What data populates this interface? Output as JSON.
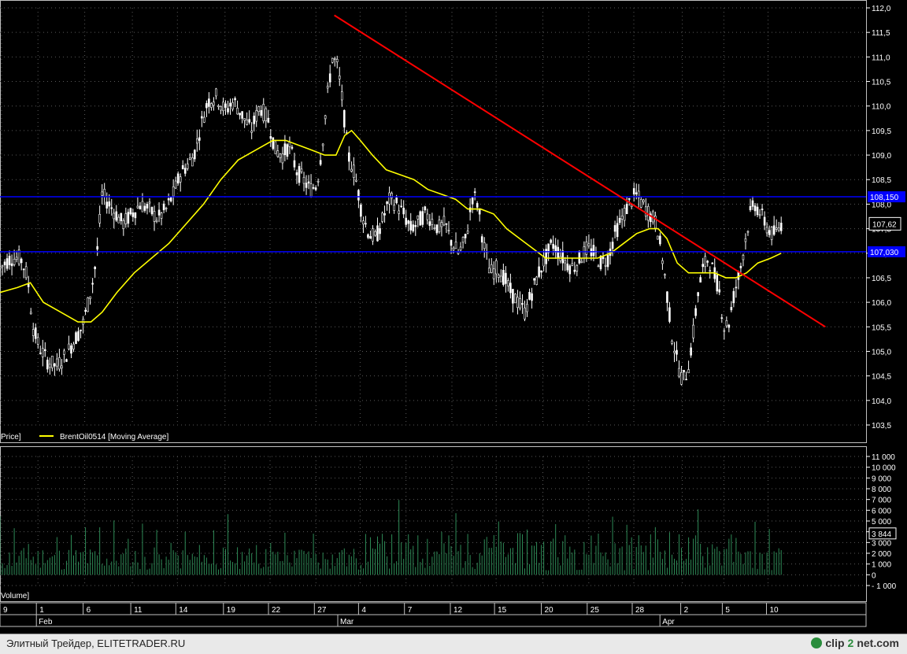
{
  "chart_data": [
    {
      "type": "candlestick",
      "ylim": [
        103.5,
        112.0
      ],
      "yticks": [
        "112,0",
        "111,5",
        "111,0",
        "110,5",
        "110,0",
        "109,5",
        "109,0",
        "108,5",
        "108,0",
        "107,5",
        "107,0",
        "106,5",
        "106,0",
        "105,5",
        "105,0",
        "104,5",
        "104,0",
        "103,5"
      ],
      "legend_left": "Price]",
      "legend_series": "BrentOil0514 [Moving Average]",
      "hlines": [
        {
          "value": 108.15,
          "label": "108,150",
          "color": "#0000ff"
        },
        {
          "value": 107.03,
          "label": "107,030",
          "color": "#0000ff"
        }
      ],
      "last_price_label": "107,62",
      "trendline": {
        "x": [
          0.386,
          0.953
        ],
        "y": [
          111.85,
          105.5
        ],
        "color": "#ff0000"
      },
      "grid": true,
      "colors": {
        "candle": "#ffffff",
        "ma": "#ffff00",
        "hline": "#0000ff",
        "trend": "#ff0000"
      },
      "price_path": [
        [
          0.0,
          106.7
        ],
        [
          0.012,
          106.9
        ],
        [
          0.024,
          106.9
        ],
        [
          0.032,
          106.5
        ],
        [
          0.038,
          105.5
        ],
        [
          0.045,
          105.1
        ],
        [
          0.055,
          104.8
        ],
        [
          0.065,
          104.7
        ],
        [
          0.075,
          104.9
        ],
        [
          0.085,
          105.2
        ],
        [
          0.095,
          105.5
        ],
        [
          0.102,
          106.0
        ],
        [
          0.108,
          106.5
        ],
        [
          0.112,
          107.0
        ],
        [
          0.118,
          108.2
        ],
        [
          0.126,
          108.0
        ],
        [
          0.134,
          107.8
        ],
        [
          0.142,
          107.6
        ],
        [
          0.152,
          107.8
        ],
        [
          0.162,
          108.0
        ],
        [
          0.172,
          107.9
        ],
        [
          0.182,
          107.7
        ],
        [
          0.192,
          107.9
        ],
        [
          0.2,
          108.2
        ],
        [
          0.208,
          108.6
        ],
        [
          0.216,
          108.8
        ],
        [
          0.224,
          109.0
        ],
        [
          0.232,
          109.6
        ],
        [
          0.24,
          110.1
        ],
        [
          0.25,
          110.2
        ],
        [
          0.26,
          109.9
        ],
        [
          0.27,
          110.1
        ],
        [
          0.28,
          109.8
        ],
        [
          0.29,
          109.5
        ],
        [
          0.3,
          110.0
        ],
        [
          0.31,
          109.7
        ],
        [
          0.318,
          109.1
        ],
        [
          0.326,
          109.0
        ],
        [
          0.334,
          109.2
        ],
        [
          0.342,
          108.7
        ],
        [
          0.35,
          108.5
        ],
        [
          0.358,
          108.3
        ],
        [
          0.366,
          108.4
        ],
        [
          0.372,
          109.2
        ],
        [
          0.378,
          110.2
        ],
        [
          0.384,
          111.0
        ],
        [
          0.39,
          110.8
        ],
        [
          0.396,
          110.0
        ],
        [
          0.402,
          109.0
        ],
        [
          0.41,
          108.6
        ],
        [
          0.418,
          107.8
        ],
        [
          0.426,
          107.4
        ],
        [
          0.434,
          107.3
        ],
        [
          0.442,
          107.7
        ],
        [
          0.45,
          108.1
        ],
        [
          0.458,
          108.0
        ],
        [
          0.466,
          107.8
        ],
        [
          0.474,
          107.5
        ],
        [
          0.482,
          107.6
        ],
        [
          0.49,
          107.8
        ],
        [
          0.498,
          107.7
        ],
        [
          0.506,
          107.5
        ],
        [
          0.514,
          107.6
        ],
        [
          0.522,
          107.2
        ],
        [
          0.53,
          107.0
        ],
        [
          0.538,
          107.3
        ],
        [
          0.546,
          108.2
        ],
        [
          0.552,
          108.0
        ],
        [
          0.558,
          107.2
        ],
        [
          0.566,
          106.6
        ],
        [
          0.574,
          106.7
        ],
        [
          0.582,
          106.5
        ],
        [
          0.59,
          106.2
        ],
        [
          0.598,
          106.0
        ],
        [
          0.606,
          105.8
        ],
        [
          0.614,
          106.2
        ],
        [
          0.622,
          106.6
        ],
        [
          0.63,
          106.9
        ],
        [
          0.638,
          107.2
        ],
        [
          0.646,
          107.0
        ],
        [
          0.654,
          106.8
        ],
        [
          0.662,
          106.7
        ],
        [
          0.67,
          106.9
        ],
        [
          0.678,
          107.1
        ],
        [
          0.686,
          107.0
        ],
        [
          0.694,
          106.8
        ],
        [
          0.702,
          106.9
        ],
        [
          0.71,
          107.4
        ],
        [
          0.718,
          107.7
        ],
        [
          0.726,
          108.0
        ],
        [
          0.734,
          108.2
        ],
        [
          0.742,
          108.0
        ],
        [
          0.75,
          107.8
        ],
        [
          0.758,
          107.6
        ],
        [
          0.764,
          107.0
        ],
        [
          0.77,
          106.2
        ],
        [
          0.776,
          105.3
        ],
        [
          0.782,
          104.8
        ],
        [
          0.788,
          104.4
        ],
        [
          0.794,
          104.6
        ],
        [
          0.8,
          105.3
        ],
        [
          0.806,
          106.2
        ],
        [
          0.812,
          106.7
        ],
        [
          0.818,
          106.9
        ],
        [
          0.824,
          106.6
        ],
        [
          0.83,
          106.3
        ],
        [
          0.836,
          105.5
        ],
        [
          0.842,
          105.6
        ],
        [
          0.848,
          106.2
        ],
        [
          0.854,
          106.6
        ],
        [
          0.86,
          107.2
        ],
        [
          0.866,
          107.8
        ],
        [
          0.872,
          108.0
        ],
        [
          0.878,
          107.8
        ],
        [
          0.884,
          107.6
        ],
        [
          0.89,
          107.4
        ],
        [
          0.896,
          107.4
        ],
        [
          0.902,
          107.6
        ]
      ],
      "ma_path": [
        [
          0.0,
          106.2
        ],
        [
          0.02,
          106.3
        ],
        [
          0.035,
          106.4
        ],
        [
          0.05,
          106.0
        ],
        [
          0.07,
          105.8
        ],
        [
          0.09,
          105.6
        ],
        [
          0.105,
          105.6
        ],
        [
          0.118,
          105.8
        ],
        [
          0.135,
          106.2
        ],
        [
          0.155,
          106.6
        ],
        [
          0.175,
          106.9
        ],
        [
          0.195,
          107.2
        ],
        [
          0.215,
          107.6
        ],
        [
          0.235,
          108.0
        ],
        [
          0.255,
          108.5
        ],
        [
          0.275,
          108.9
        ],
        [
          0.295,
          109.1
        ],
        [
          0.315,
          109.3
        ],
        [
          0.33,
          109.3
        ],
        [
          0.345,
          109.2
        ],
        [
          0.36,
          109.1
        ],
        [
          0.375,
          109.0
        ],
        [
          0.388,
          109.0
        ],
        [
          0.398,
          109.4
        ],
        [
          0.406,
          109.5
        ],
        [
          0.416,
          109.3
        ],
        [
          0.43,
          109.0
        ],
        [
          0.446,
          108.7
        ],
        [
          0.462,
          108.6
        ],
        [
          0.478,
          108.5
        ],
        [
          0.494,
          108.3
        ],
        [
          0.51,
          108.2
        ],
        [
          0.526,
          108.1
        ],
        [
          0.54,
          107.9
        ],
        [
          0.555,
          107.9
        ],
        [
          0.57,
          107.8
        ],
        [
          0.585,
          107.5
        ],
        [
          0.6,
          107.3
        ],
        [
          0.615,
          107.1
        ],
        [
          0.63,
          106.9
        ],
        [
          0.645,
          106.9
        ],
        [
          0.66,
          106.9
        ],
        [
          0.675,
          106.9
        ],
        [
          0.69,
          106.9
        ],
        [
          0.705,
          107.0
        ],
        [
          0.72,
          107.2
        ],
        [
          0.735,
          107.4
        ],
        [
          0.75,
          107.5
        ],
        [
          0.76,
          107.5
        ],
        [
          0.77,
          107.3
        ],
        [
          0.782,
          106.8
        ],
        [
          0.795,
          106.6
        ],
        [
          0.81,
          106.6
        ],
        [
          0.825,
          106.6
        ],
        [
          0.838,
          106.5
        ],
        [
          0.85,
          106.5
        ],
        [
          0.862,
          106.6
        ],
        [
          0.875,
          106.8
        ],
        [
          0.89,
          106.9
        ],
        [
          0.902,
          107.0
        ]
      ]
    },
    {
      "type": "bar",
      "ylim": [
        -1000,
        11000
      ],
      "yticks": [
        "11 000",
        "10 000",
        "9 000",
        "8 000",
        "7 000",
        "6 000",
        "5 000",
        "4 000",
        "3 000",
        "2 000",
        "1 000",
        "0",
        "- 1 000"
      ],
      "legend_left": "Volume]",
      "last_value_label": "3 844",
      "color": "#2e8b57"
    }
  ],
  "x_axis": {
    "day_ticks": [
      {
        "x": 0.0,
        "label": "9"
      },
      {
        "x": 0.042,
        "label": "1"
      },
      {
        "x": 0.096,
        "label": "6"
      },
      {
        "x": 0.151,
        "label": "11"
      },
      {
        "x": 0.203,
        "label": "14"
      },
      {
        "x": 0.258,
        "label": "19"
      },
      {
        "x": 0.31,
        "label": "22"
      },
      {
        "x": 0.363,
        "label": "27"
      },
      {
        "x": 0.414,
        "label": "4"
      },
      {
        "x": 0.467,
        "label": "7"
      },
      {
        "x": 0.52,
        "label": "12"
      },
      {
        "x": 0.571,
        "label": "15"
      },
      {
        "x": 0.625,
        "label": "20"
      },
      {
        "x": 0.678,
        "label": "25"
      },
      {
        "x": 0.73,
        "label": "28"
      },
      {
        "x": 0.786,
        "label": "2"
      },
      {
        "x": 0.834,
        "label": "5"
      },
      {
        "x": 0.885,
        "label": "10"
      }
    ],
    "month_ticks": [
      {
        "x": 0.042,
        "label": "Feb"
      },
      {
        "x": 0.39,
        "label": "Mar"
      },
      {
        "x": 0.762,
        "label": "Apr"
      }
    ]
  },
  "footer": {
    "left_text": "Элитный Трейдер, ELITETRADER.RU",
    "logo_a": "clip",
    "logo_b": "2",
    "logo_c": "net.com"
  }
}
